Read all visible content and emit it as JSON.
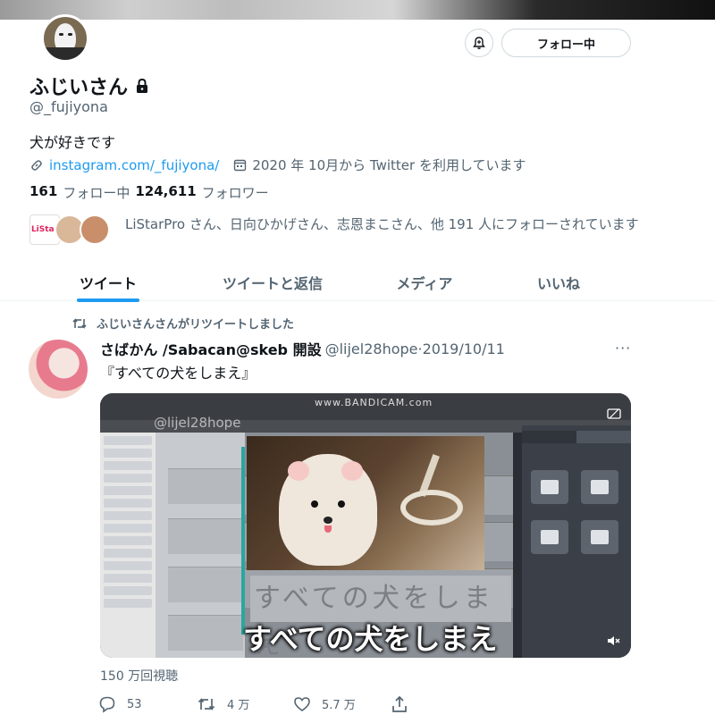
{
  "profile": {
    "display_name": "ふじいさん",
    "handle": "@_fujiyona",
    "bio": "犬が好きです",
    "link": "instagram.com/_fujiyona/",
    "joined": "2020 年 10月から Twitter を利用しています",
    "following_count": "161",
    "following_label": "フォロー中",
    "followers_count": "124,611",
    "followers_label": "フォロワー",
    "followed_by": "LiStarPro さん、日向ひかげさん、志恩まこさん、他 191 人にフォローされています",
    "followed_by_avatar_text": "LiStar"
  },
  "header_buttons": {
    "follow_label": "フォロー中"
  },
  "tabs": [
    {
      "label": "ツイート",
      "active": true
    },
    {
      "label": "ツイートと返信",
      "active": false
    },
    {
      "label": "メディア",
      "active": false
    },
    {
      "label": "いいね",
      "active": false
    }
  ],
  "tweet": {
    "retweeted_by": "ふじいさんさんがリツイートしました",
    "author_name": "さばかん /Sabacan@skeb 開設",
    "author_handle": "@lijel28hope",
    "separator": "·",
    "date": "2019/10/11",
    "more": "···",
    "text": "『すべての犬をしまえ』",
    "media": {
      "watermark": "@lijel28hope",
      "recorder_label": "www.BANDICAM.com",
      "subtitle": "すべての犬をしまえ",
      "pixel_caption": "すべての犬をしまえ"
    },
    "views": "150 万回視聴",
    "replies": "53",
    "retweets": "4 万",
    "likes": "5.7 万"
  },
  "colors": {
    "accent": "#1d9bf0",
    "text_primary": "#0f1419",
    "text_secondary": "#536471"
  },
  "icons": [
    "bell-plus-icon",
    "lock-icon",
    "link-icon",
    "calendar-icon",
    "retweet-icon",
    "more-icon",
    "gif-badge-icon",
    "mute-icon",
    "reply-icon",
    "like-icon",
    "share-icon"
  ]
}
